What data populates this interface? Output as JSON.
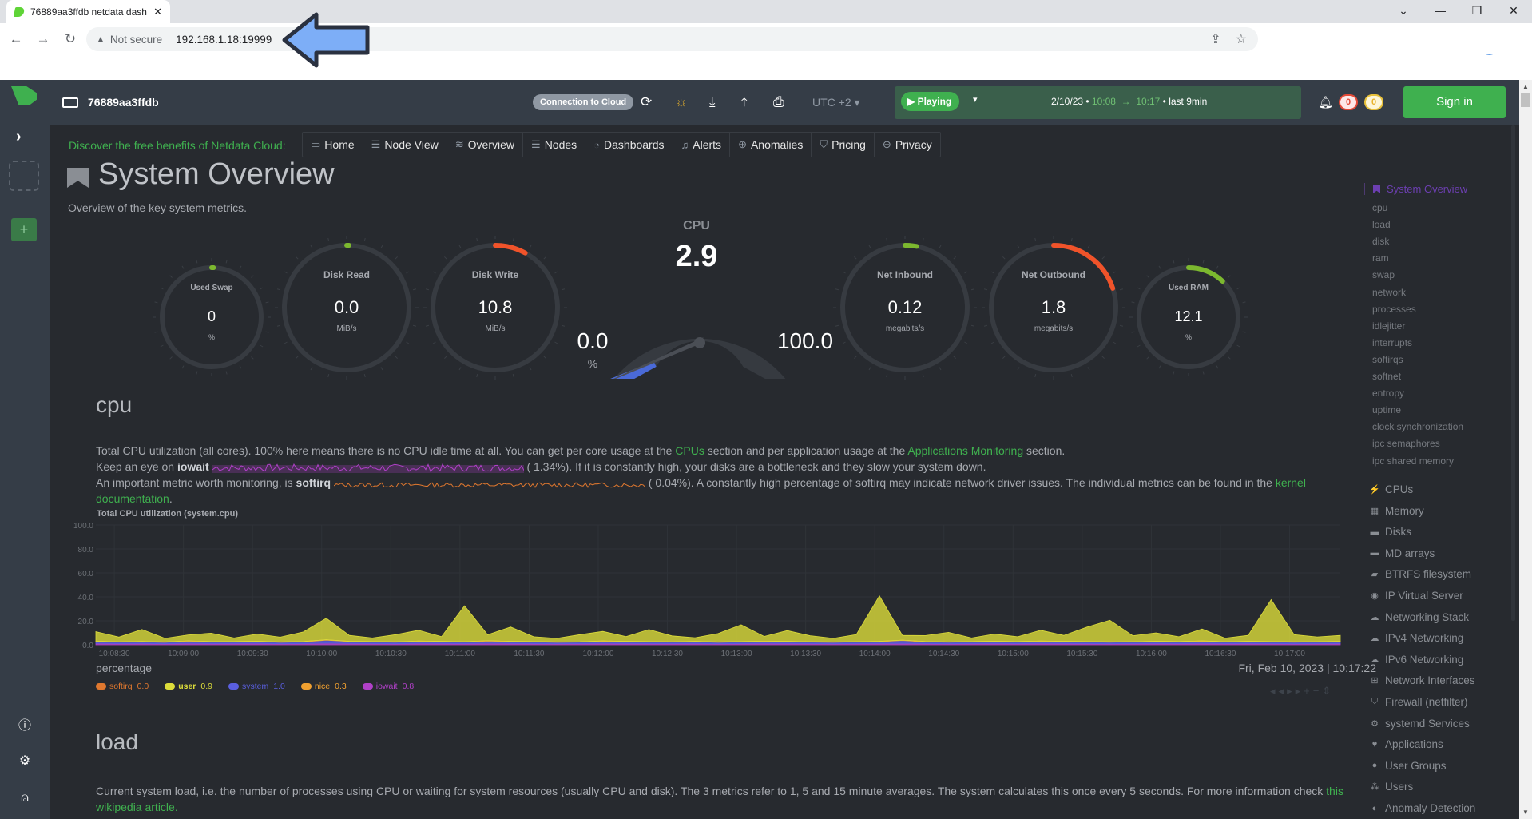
{
  "browser": {
    "tab_title": "76889aa3ffdb netdata dash",
    "not_secure": "Not secure",
    "url": "192.168.1.18:19999",
    "win_controls": {
      "dropdown": "⌄",
      "minimize": "—",
      "restore": "❐",
      "close": "✕"
    }
  },
  "header": {
    "hostname": "76889aa3ffdb",
    "connection_label": "Connection to Cloud",
    "timezone": "UTC +2",
    "playing_label": "Playing",
    "date": "2/10/23",
    "time_from": "10:08",
    "time_to": "10:17",
    "range_suffix": "last 9min",
    "alerts_critical": "0",
    "alerts_warning": "0",
    "sign_in": "Sign in",
    "accent": "#3fb04f"
  },
  "promo": "Discover the free benefits of Netdata Cloud:",
  "menu": [
    {
      "icon": "monitor-icon",
      "label": "Home"
    },
    {
      "icon": "server-icon",
      "label": "Node View"
    },
    {
      "icon": "chart-icon",
      "label": "Overview"
    },
    {
      "icon": "server-icon",
      "label": "Nodes"
    },
    {
      "icon": "dashboard-icon",
      "label": "Dashboards"
    },
    {
      "icon": "bell-icon",
      "label": "Alerts"
    },
    {
      "icon": "magnifier-icon",
      "label": "Anomalies"
    },
    {
      "icon": "shield-icon",
      "label": "Pricing"
    },
    {
      "icon": "lock-icon",
      "label": "Privacy"
    }
  ],
  "overview": {
    "title": "System Overview",
    "subtitle": "Overview of the key system metrics."
  },
  "gauges": {
    "swap": {
      "label": "Used Swap",
      "value": "0",
      "unit": "%",
      "fraction": 0.0,
      "color": "#7cb82f"
    },
    "disk_read": {
      "label": "Disk Read",
      "value": "0.0",
      "unit": "MiB/s",
      "fraction": 0.0,
      "color": "#7cb82f"
    },
    "disk_write": {
      "label": "Disk Write",
      "value": "10.8",
      "unit": "MiB/s",
      "fraction": 0.08,
      "color": "#f0532a"
    },
    "cpu": {
      "label": "CPU",
      "value": "2.9",
      "min": "0.0",
      "max": "100.0",
      "unit": "%",
      "fraction": 0.029
    },
    "net_in": {
      "label": "Net Inbound",
      "value": "0.12",
      "unit": "megabits/s",
      "fraction": 0.03,
      "color": "#7cb82f"
    },
    "net_out": {
      "label": "Net Outbound",
      "value": "1.8",
      "unit": "megabits/s",
      "fraction": 0.2,
      "color": "#f0532a"
    },
    "ram": {
      "label": "Used RAM",
      "value": "12.1",
      "unit": "%",
      "fraction": 0.121,
      "color": "#7cb82f"
    }
  },
  "cpu_section": {
    "title": "cpu",
    "line1_a": "Total CPU utilization (all cores). 100% here means there is no CPU idle time at all. You can get per core usage at the ",
    "link_cpus": "CPUs",
    "line1_b": " section and per application usage at the ",
    "link_apps": "Applications Monitoring",
    "line1_c": " section.",
    "line2_a": "Keep an eye on ",
    "line2_bold": "iowait",
    "line2_val": "(      1.34%). If it is constantly high, your disks are a bottleneck and they slow your system down.",
    "line3_a": "An important metric worth monitoring, is ",
    "line3_bold": "softirq",
    "line3_val": "(      0.04%). A constantly high percentage of softirq may indicate network driver issues. The individual metrics can be found in the ",
    "link_kernel": "kernel documentation",
    "link_kernel_end": ".",
    "chart_title": "Total CPU utilization (system.cpu)",
    "units": "percentage",
    "timestamp": "Fri, Feb 10, 2023 | 10:17:22",
    "legend": [
      {
        "name": "softirq",
        "value": "0.0",
        "color": "#e0782f"
      },
      {
        "name": "user",
        "value": "0.9",
        "color": "#dcdc3a"
      },
      {
        "name": "system",
        "value": "1.0",
        "color": "#5a5fe0"
      },
      {
        "name": "nice",
        "value": "0.3",
        "color": "#f0a030"
      },
      {
        "name": "iowait",
        "value": "0.8",
        "color": "#b040c8"
      }
    ]
  },
  "chart_data": {
    "type": "area",
    "title": "Total CPU utilization (system.cpu)",
    "xlabel": "",
    "ylabel": "percentage",
    "ylim": [
      0,
      100
    ],
    "yticks": [
      "100.0",
      "80.0",
      "60.0",
      "40.0",
      "20.0",
      "0.0"
    ],
    "xticks": [
      "10:08:30",
      "10:09:00",
      "10:09:30",
      "10:10:00",
      "10:10:30",
      "10:11:00",
      "10:11:30",
      "10:12:00",
      "10:12:30",
      "10:13:00",
      "10:13:30",
      "10:14:00",
      "10:14:30",
      "10:15:00",
      "10:15:30",
      "10:16:00",
      "10:16:30",
      "10:17:00"
    ],
    "grid": true,
    "stacked": true,
    "x_start": "10:08:22",
    "x_end": "10:17:22",
    "series": [
      {
        "name": "iowait",
        "color": "#b040c8",
        "values": [
          1.2,
          1.0,
          1.1,
          0.9,
          1.3,
          1.0,
          1.1,
          1.2,
          0.9,
          1.0,
          1.4,
          1.1,
          1.0,
          0.9,
          1.2,
          1.1,
          1.0,
          1.3,
          1.1,
          1.0,
          0.9,
          1.0,
          1.2,
          1.1,
          1.0,
          1.0,
          1.1,
          0.9,
          1.0,
          1.2,
          1.1,
          1.0,
          0.9,
          1.0,
          1.1,
          1.2,
          1.0,
          0.9,
          1.0,
          1.1,
          1.0,
          1.2,
          1.1,
          1.0,
          0.9,
          1.0,
          1.1,
          1.0,
          1.2,
          1.0,
          1.1,
          1.0,
          0.9,
          1.0,
          1.1
        ]
      },
      {
        "name": "system",
        "color": "#5a5fe0",
        "values": [
          1.5,
          1.3,
          1.4,
          1.2,
          1.8,
          1.4,
          1.3,
          1.6,
          1.2,
          1.4,
          2.5,
          1.6,
          1.4,
          1.3,
          1.7,
          1.5,
          1.3,
          1.8,
          1.6,
          1.4,
          1.2,
          1.3,
          1.7,
          1.5,
          1.4,
          1.3,
          1.5,
          1.2,
          1.4,
          1.6,
          1.5,
          1.3,
          1.2,
          1.4,
          1.5,
          2.4,
          1.4,
          1.3,
          1.4,
          1.6,
          1.4,
          1.7,
          1.5,
          1.4,
          1.3,
          1.4,
          1.6,
          1.4,
          1.7,
          1.4,
          1.5,
          1.4,
          1.3,
          1.4,
          1.5
        ]
      },
      {
        "name": "user",
        "color": "#dcdc3a",
        "values": [
          8,
          4,
          10,
          3,
          5,
          7,
          3,
          6,
          4,
          8,
          18,
          5,
          3,
          6,
          9,
          4,
          30,
          5,
          12,
          4,
          3,
          6,
          8,
          4,
          10,
          5,
          3,
          7,
          14,
          4,
          9,
          5,
          3,
          6,
          38,
          4,
          5,
          8,
          3,
          6,
          4,
          9,
          5,
          12,
          18,
          5,
          7,
          4,
          10,
          3,
          5,
          35,
          6,
          4,
          5
        ]
      },
      {
        "name": "nice",
        "color": "#f0a030",
        "values": [
          0.3,
          0.2,
          0.3,
          0.3,
          0.2,
          0.3,
          0.3,
          0.2,
          0.3,
          0.3,
          0.3,
          0.2,
          0.3,
          0.3,
          0.2,
          0.3,
          0.3,
          0.3,
          0.2,
          0.3,
          0.3,
          0.2,
          0.3,
          0.3,
          0.3,
          0.2,
          0.3,
          0.3,
          0.3,
          0.2,
          0.3,
          0.3,
          0.3,
          0.2,
          0.3,
          0.3,
          0.3,
          0.2,
          0.3,
          0.3,
          0.3,
          0.2,
          0.3,
          0.3,
          0.3,
          0.2,
          0.3,
          0.3,
          0.3,
          0.2,
          0.3,
          0.3,
          0.3,
          0.2,
          0.3
        ]
      },
      {
        "name": "softirq",
        "color": "#e0782f",
        "values": [
          0,
          0,
          0,
          0,
          0,
          0,
          0,
          0,
          0,
          0,
          0,
          0,
          0,
          0,
          0,
          0,
          0,
          0,
          0,
          0,
          0,
          0,
          0,
          0,
          0,
          0,
          0,
          0,
          0,
          0,
          0,
          0,
          0,
          0,
          0,
          0,
          0,
          0,
          0,
          0,
          0,
          0,
          0,
          0,
          0,
          0,
          0,
          0,
          0,
          0,
          0,
          0,
          0,
          0,
          0
        ]
      }
    ]
  },
  "load_section": {
    "title": "load",
    "text": "Current system load, i.e. the number of processes using CPU or waiting for system resources (usually CPU and disk). The 3 metrics refer to 1, 5 and 15 minute averages. The system calculates this once every 5 seconds. For more information check ",
    "link": "this wikipedia article."
  },
  "toc": {
    "active": "System Overview",
    "subitems": [
      "cpu",
      "load",
      "disk",
      "ram",
      "swap",
      "network",
      "processes",
      "idlejitter",
      "interrupts",
      "softirqs",
      "softnet",
      "entropy",
      "uptime",
      "clock synchronization",
      "ipc semaphores",
      "ipc shared memory"
    ],
    "groups": [
      {
        "icon": "bolt-icon",
        "glyph": "⚡",
        "label": "CPUs"
      },
      {
        "icon": "memory-icon",
        "glyph": "▦",
        "label": "Memory"
      },
      {
        "icon": "hdd-icon",
        "glyph": "▬",
        "label": "Disks"
      },
      {
        "icon": "hdd-icon",
        "glyph": "▬",
        "label": "MD arrays"
      },
      {
        "icon": "folder-icon",
        "glyph": "▰",
        "label": "BTRFS filesystem"
      },
      {
        "icon": "eye-icon",
        "glyph": "◉",
        "label": "IP Virtual Server"
      },
      {
        "icon": "cloud-icon",
        "glyph": "☁",
        "label": "Networking Stack"
      },
      {
        "icon": "cloud-icon",
        "glyph": "☁",
        "label": "IPv4 Networking"
      },
      {
        "icon": "cloud-icon",
        "glyph": "☁",
        "label": "IPv6 Networking"
      },
      {
        "icon": "sitemap-icon",
        "glyph": "⊞",
        "label": "Network Interfaces"
      },
      {
        "icon": "shield-icon",
        "glyph": "⛉",
        "label": "Firewall (netfilter)"
      },
      {
        "icon": "gears-icon",
        "glyph": "⚙",
        "label": "systemd Services"
      },
      {
        "icon": "heartbeat-icon",
        "glyph": "♥",
        "label": "Applications"
      },
      {
        "icon": "user-icon",
        "glyph": "●",
        "label": "User Groups"
      },
      {
        "icon": "users-icon",
        "glyph": "⁂",
        "label": "Users"
      },
      {
        "icon": "brain-icon",
        "glyph": "◐",
        "label": "Anomaly Detection"
      }
    ]
  }
}
